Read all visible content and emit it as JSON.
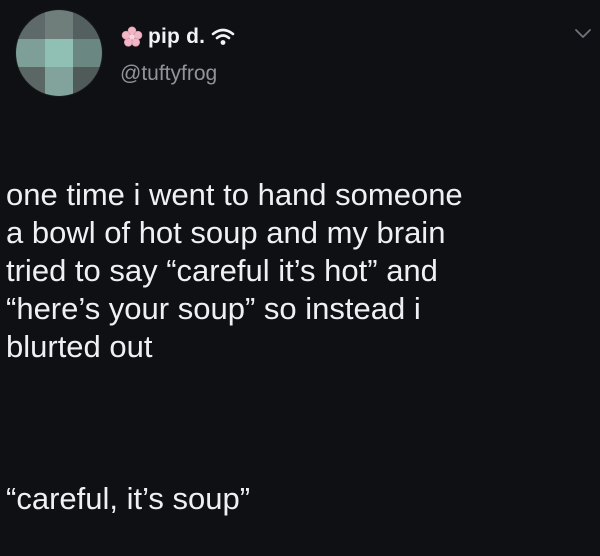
{
  "tweet": {
    "display_name": "pip d.",
    "handle": "@tuftyfrog",
    "icons": {
      "name_prefix": "flower-icon",
      "name_suffix": "wifi-icon",
      "menu": "chevron-down-icon"
    },
    "text": {
      "paragraph_1": "one time i went to hand someone\na bowl of hot soup and my brain\ntried to say “careful it’s hot” and\n“here’s your soup” so instead i\nblurted out",
      "paragraph_2": "“careful, it’s soup”"
    }
  },
  "colors": {
    "background": "#0f1014",
    "text_primary": "#eef0f3",
    "text_secondary": "#8f949b",
    "flower_accent": "#f0b7c6"
  }
}
